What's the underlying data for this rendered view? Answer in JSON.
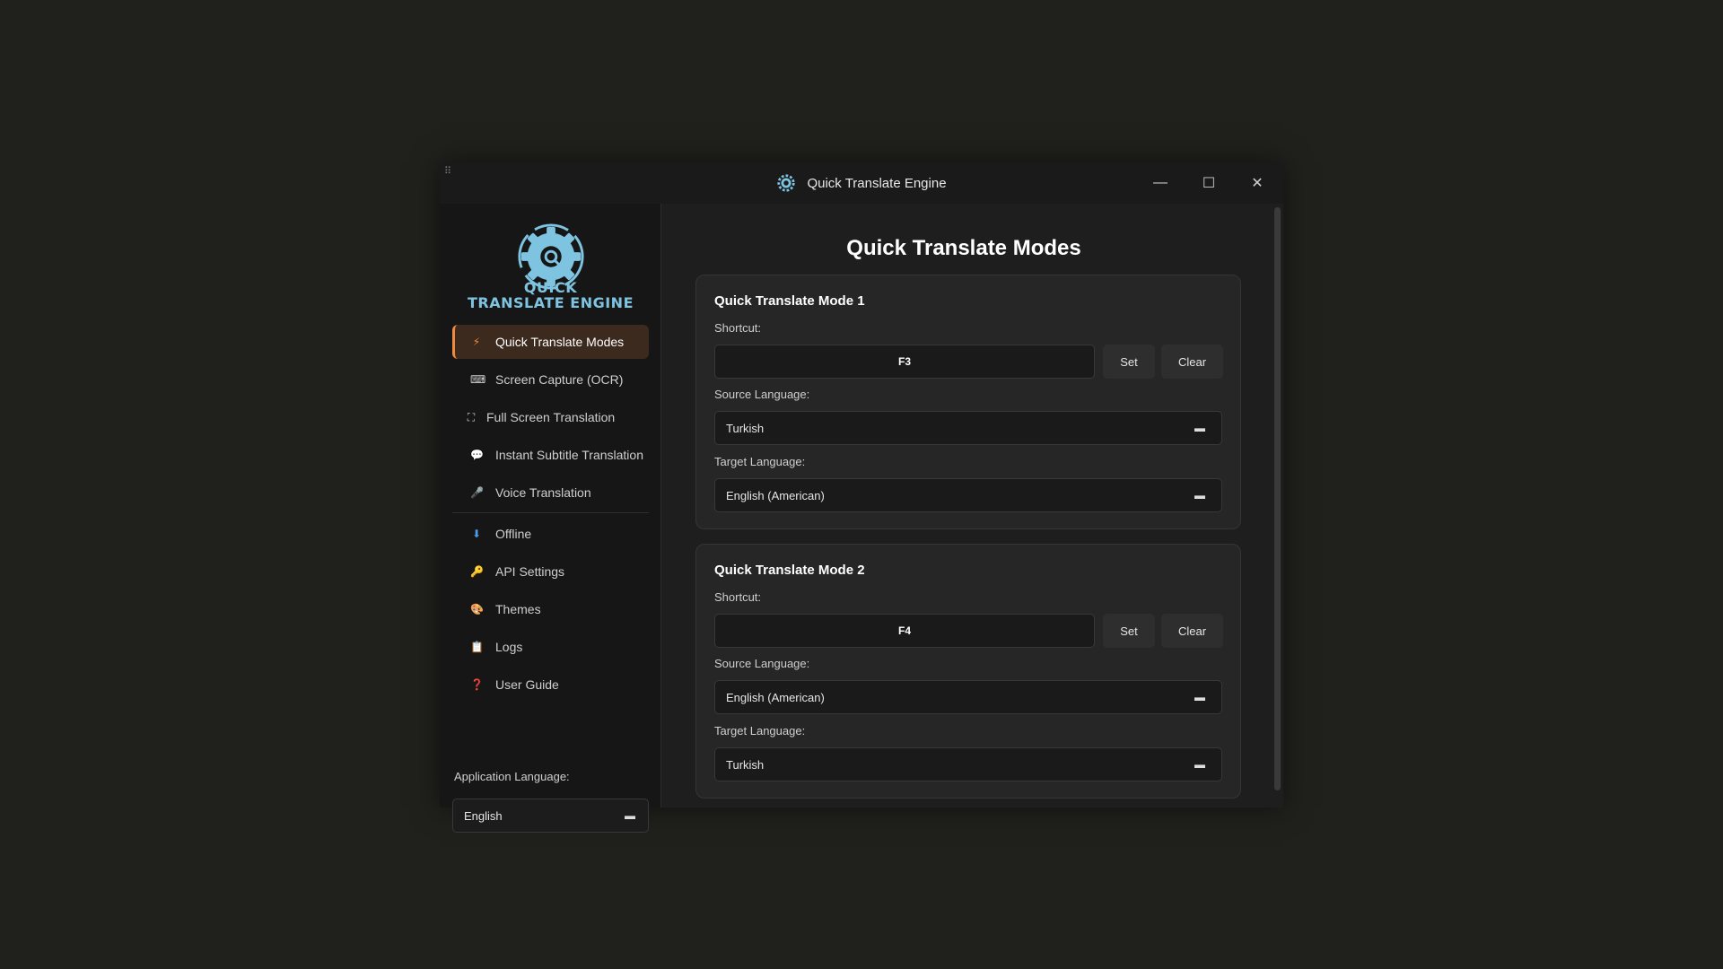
{
  "window": {
    "title": "Quick Translate Engine",
    "minimize_icon": "minimize-icon",
    "maximize_icon": "maximize-icon",
    "close_icon": "close-icon"
  },
  "logo": {
    "line1": "QUICK",
    "line2": "TRANSLATE ENGINE",
    "icon": "gear-translate-logo"
  },
  "sidebar": {
    "items": [
      {
        "label": "Quick Translate Modes",
        "icon": "lightning-icon",
        "glyph": "⚡",
        "active": true
      },
      {
        "label": "Screen Capture (OCR)",
        "icon": "keyboard-icon",
        "glyph": "⌨",
        "active": false
      },
      {
        "label": "Full Screen Translation",
        "icon": "fullscreen-icon",
        "glyph": "⛶",
        "active": false
      },
      {
        "label": "Instant Subtitle Translation",
        "icon": "speech-bubble-icon",
        "glyph": "💬",
        "active": false
      },
      {
        "label": "Voice Translation",
        "icon": "microphone-icon",
        "glyph": "🎤",
        "active": false
      },
      {
        "label": "Offline",
        "icon": "download-icon",
        "glyph": "⬇",
        "active": false
      },
      {
        "label": "API Settings",
        "icon": "key-icon",
        "glyph": "🔑",
        "active": false
      },
      {
        "label": "Themes",
        "icon": "palette-icon",
        "glyph": "🎨",
        "active": false
      },
      {
        "label": "Logs",
        "icon": "clipboard-icon",
        "glyph": "📋",
        "active": false
      },
      {
        "label": "User Guide",
        "icon": "question-icon",
        "glyph": "❓",
        "active": false
      }
    ],
    "app_language_label": "Application Language:",
    "app_language_value": "English"
  },
  "main": {
    "title": "Quick Translate Modes",
    "modes": [
      {
        "title": "Quick Translate Mode 1",
        "shortcut_label": "Shortcut:",
        "shortcut": "F3",
        "set_label": "Set",
        "clear_label": "Clear",
        "source_label": "Source Language:",
        "source": "Turkish",
        "target_label": "Target Language:",
        "target": "English (American)"
      },
      {
        "title": "Quick Translate Mode 2",
        "shortcut_label": "Shortcut:",
        "shortcut": "F4",
        "set_label": "Set",
        "clear_label": "Clear",
        "source_label": "Source Language:",
        "source": "English (American)",
        "target_label": "Target Language:",
        "target": "Turkish"
      }
    ]
  },
  "colors": {
    "accent": "#f08a3c",
    "logo_blue": "#7ec3e0",
    "background": "#1e1e1e",
    "sidebar": "#161616"
  }
}
